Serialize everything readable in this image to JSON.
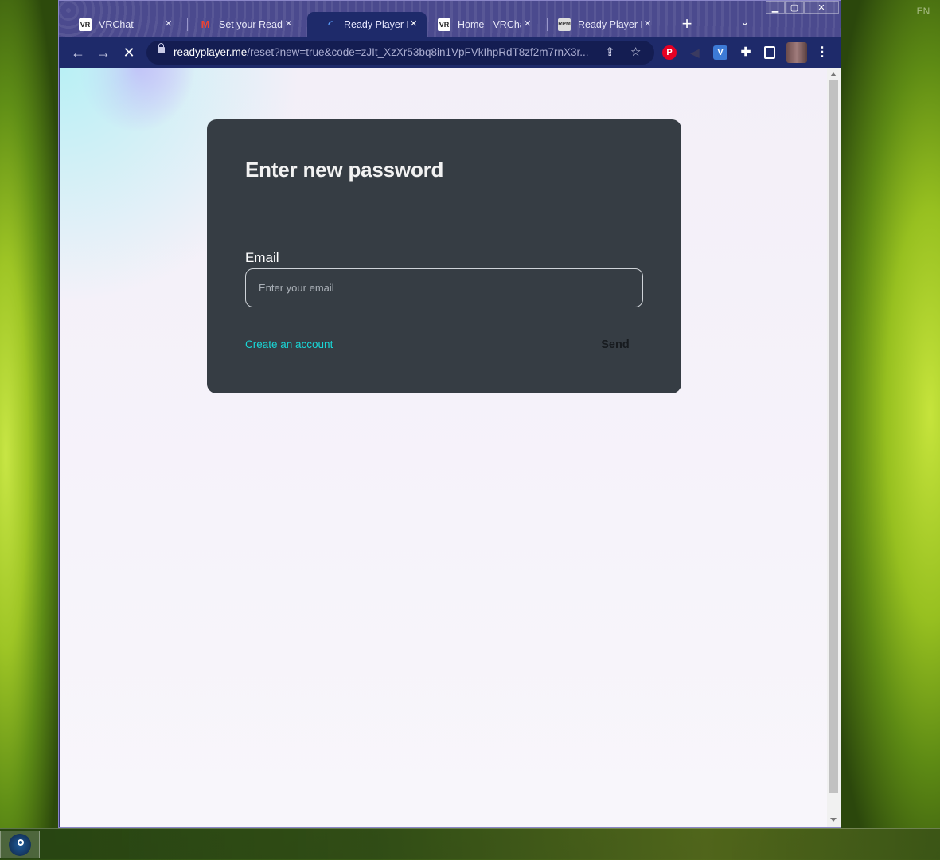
{
  "desktop": {
    "language_indicator": "EN"
  },
  "browser": {
    "tabs": [
      {
        "title": "VRChat",
        "favicon": "vrchat-icon",
        "active": false
      },
      {
        "title": "Set your Ready",
        "favicon": "gmail-icon",
        "active": false
      },
      {
        "title": "Ready Player Me",
        "favicon": "loading-icon",
        "active": true
      },
      {
        "title": "Home - VRChat",
        "favicon": "vrchat-icon",
        "active": false
      },
      {
        "title": "Ready Player M",
        "favicon": "readyplayerme-icon",
        "active": false
      }
    ],
    "tab_close_glyph": "×",
    "new_tab_glyph": "+",
    "window_controls": [
      "minimize",
      "maximize",
      "close"
    ],
    "address": {
      "host": "readyplayer.me",
      "path": "/reset?new=true&code=zJIt_XzXr53bq8in1VpFVkIhpRdT8zf2m7rnX3r..."
    },
    "extensions": [
      "pinterest-icon",
      "mute-icon",
      "vrchat-ext-icon",
      "puzzle-icon",
      "sidepanel-icon",
      "profile-avatar",
      "menu-icon"
    ]
  },
  "page": {
    "title": "Enter new password",
    "email_label": "Email",
    "email_placeholder": "Enter your email",
    "email_value": "",
    "create_account_link": "Create an account",
    "send_button": "Send",
    "colors": {
      "card_bg": "#363d44",
      "link": "#19d6d6",
      "page_bg": "#f4f1f9"
    }
  }
}
